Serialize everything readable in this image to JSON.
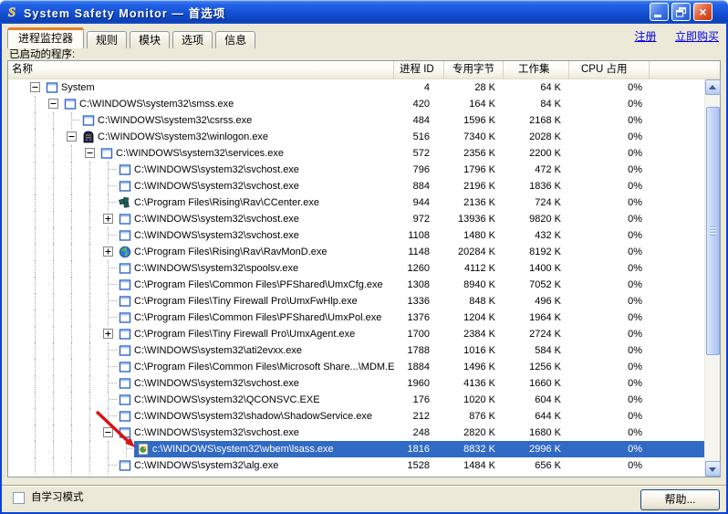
{
  "window": {
    "title": "System Safety Monitor — 首选项"
  },
  "icons": {
    "app_logo": "ssm-s-logo",
    "titlebar": [
      "minimize-icon",
      "restore-icon",
      "close-icon"
    ]
  },
  "tabs": [
    {
      "label": "进程监控器",
      "active": true
    },
    {
      "label": "规则",
      "active": false
    },
    {
      "label": "模块",
      "active": false
    },
    {
      "label": "选项",
      "active": false
    },
    {
      "label": "信息",
      "active": false
    }
  ],
  "links": [
    {
      "label": "注册"
    },
    {
      "label": "立即购买"
    }
  ],
  "list_label": "已启动的程序:",
  "table": {
    "columns": [
      "名称",
      "进程 ID",
      "专用字节",
      "工作集",
      "CPU 占用"
    ],
    "rows": [
      {
        "name": "System",
        "pid": "4",
        "private_bytes": "28 K",
        "working_set": "64 K",
        "cpu": "0%",
        "level": 0,
        "expander": "collapse",
        "icon": "window-icon",
        "selected": false
      },
      {
        "name": "C:\\WINDOWS\\system32\\smss.exe",
        "pid": "420",
        "private_bytes": "164 K",
        "working_set": "84 K",
        "cpu": "0%",
        "level": 1,
        "expander": "collapse",
        "icon": "window-icon",
        "selected": false
      },
      {
        "name": "C:\\WINDOWS\\system32\\csrss.exe",
        "pid": "484",
        "private_bytes": "1596 K",
        "working_set": "2168 K",
        "cpu": "0%",
        "level": 2,
        "expander": null,
        "icon": "window-icon",
        "selected": false
      },
      {
        "name": "C:\\WINDOWS\\system32\\winlogon.exe",
        "pid": "516",
        "private_bytes": "7340 K",
        "working_set": "2028 K",
        "cpu": "0%",
        "level": 2,
        "expander": "collapse",
        "icon": "winlogon-icon",
        "selected": false
      },
      {
        "name": "C:\\WINDOWS\\system32\\services.exe",
        "pid": "572",
        "private_bytes": "2356 K",
        "working_set": "2200 K",
        "cpu": "0%",
        "level": 3,
        "expander": "collapse",
        "icon": "window-icon",
        "selected": false
      },
      {
        "name": "C:\\WINDOWS\\system32\\svchost.exe",
        "pid": "796",
        "private_bytes": "1796 K",
        "working_set": "472 K",
        "cpu": "0%",
        "level": 4,
        "expander": null,
        "icon": "window-icon",
        "selected": false
      },
      {
        "name": "C:\\WINDOWS\\system32\\svchost.exe",
        "pid": "884",
        "private_bytes": "2196 K",
        "working_set": "1836 K",
        "cpu": "0%",
        "level": 4,
        "expander": null,
        "icon": "window-icon",
        "selected": false
      },
      {
        "name": "C:\\Program Files\\Rising\\Rav\\CCenter.exe",
        "pid": "944",
        "private_bytes": "2136 K",
        "working_set": "724 K",
        "cpu": "0%",
        "level": 4,
        "expander": null,
        "icon": "ccenter-icon",
        "selected": false
      },
      {
        "name": "C:\\WINDOWS\\system32\\svchost.exe",
        "pid": "972",
        "private_bytes": "13936 K",
        "working_set": "9820 K",
        "cpu": "0%",
        "level": 4,
        "expander": "expand",
        "icon": "window-icon",
        "selected": false
      },
      {
        "name": "C:\\WINDOWS\\system32\\svchost.exe",
        "pid": "1108",
        "private_bytes": "1480 K",
        "working_set": "432 K",
        "cpu": "0%",
        "level": 4,
        "expander": null,
        "icon": "window-icon",
        "selected": false
      },
      {
        "name": "C:\\Program Files\\Rising\\Rav\\RavMonD.exe",
        "pid": "1148",
        "private_bytes": "20284 K",
        "working_set": "8192 K",
        "cpu": "0%",
        "level": 4,
        "expander": "expand",
        "icon": "globe-icon",
        "selected": false
      },
      {
        "name": "C:\\WINDOWS\\system32\\spoolsv.exe",
        "pid": "1260",
        "private_bytes": "4112 K",
        "working_set": "1400 K",
        "cpu": "0%",
        "level": 4,
        "expander": null,
        "icon": "window-icon",
        "selected": false
      },
      {
        "name": "C:\\Program Files\\Common Files\\PFShared\\UmxCfg.exe",
        "pid": "1308",
        "private_bytes": "8940 K",
        "working_set": "7052 K",
        "cpu": "0%",
        "level": 4,
        "expander": null,
        "icon": "window-icon",
        "selected": false
      },
      {
        "name": "C:\\Program Files\\Tiny Firewall Pro\\UmxFwHlp.exe",
        "pid": "1336",
        "private_bytes": "848 K",
        "working_set": "496 K",
        "cpu": "0%",
        "level": 4,
        "expander": null,
        "icon": "window-icon",
        "selected": false
      },
      {
        "name": "C:\\Program Files\\Common Files\\PFShared\\UmxPol.exe",
        "pid": "1376",
        "private_bytes": "1204 K",
        "working_set": "1964 K",
        "cpu": "0%",
        "level": 4,
        "expander": null,
        "icon": "window-icon",
        "selected": false
      },
      {
        "name": "C:\\Program Files\\Tiny Firewall Pro\\UmxAgent.exe",
        "pid": "1700",
        "private_bytes": "2384 K",
        "working_set": "2724 K",
        "cpu": "0%",
        "level": 4,
        "expander": "expand",
        "icon": "window-icon",
        "selected": false
      },
      {
        "name": "C:\\WINDOWS\\system32\\ati2evxx.exe",
        "pid": "1788",
        "private_bytes": "1016 K",
        "working_set": "584 K",
        "cpu": "0%",
        "level": 4,
        "expander": null,
        "icon": "window-icon",
        "selected": false
      },
      {
        "name": "C:\\Program Files\\Common Files\\Microsoft Share...\\MDM.EXE",
        "pid": "1884",
        "private_bytes": "1496 K",
        "working_set": "1256 K",
        "cpu": "0%",
        "level": 4,
        "expander": null,
        "icon": "window-icon",
        "selected": false
      },
      {
        "name": "C:\\WINDOWS\\system32\\svchost.exe",
        "pid": "1960",
        "private_bytes": "4136 K",
        "working_set": "1660 K",
        "cpu": "0%",
        "level": 4,
        "expander": null,
        "icon": "window-icon",
        "selected": false
      },
      {
        "name": "C:\\WINDOWS\\system32\\QCONSVC.EXE",
        "pid": "176",
        "private_bytes": "1020 K",
        "working_set": "604 K",
        "cpu": "0%",
        "level": 4,
        "expander": null,
        "icon": "window-icon",
        "selected": false
      },
      {
        "name": "C:\\WINDOWS\\system32\\shadow\\ShadowService.exe",
        "pid": "212",
        "private_bytes": "876 K",
        "working_set": "644 K",
        "cpu": "0%",
        "level": 4,
        "expander": null,
        "icon": "window-icon",
        "selected": false
      },
      {
        "name": "C:\\WINDOWS\\system32\\svchost.exe",
        "pid": "248",
        "private_bytes": "2820 K",
        "working_set": "1680 K",
        "cpu": "0%",
        "level": 4,
        "expander": "collapse",
        "icon": "window-icon",
        "selected": false
      },
      {
        "name": "c:\\WINDOWS\\system32\\wbem\\lsass.exe",
        "pid": "1816",
        "private_bytes": "8832 K",
        "working_set": "2996 K",
        "cpu": "0%",
        "level": 5,
        "expander": null,
        "icon": "wbem-icon",
        "selected": true
      },
      {
        "name": "C:\\WINDOWS\\system32\\alg.exe",
        "pid": "1528",
        "private_bytes": "1484 K",
        "working_set": "656 K",
        "cpu": "0%",
        "level": 4,
        "expander": null,
        "icon": "window-icon",
        "selected": false
      }
    ]
  },
  "footer": {
    "self_learn_label": "自学习模式",
    "self_learn_checked": false,
    "help_label": "帮助..."
  },
  "annotation": {
    "type": "red-arrow",
    "points_to": "selected lsass.exe row icon"
  },
  "colors": {
    "titlebar_top": "#6aa0f8",
    "titlebar_bottom": "#0e40b4",
    "body": "#ece9d8",
    "selection": "#316ac5",
    "link": "#0000e6",
    "tab_accent": "#e5822a",
    "arrow": "#dd1010"
  }
}
